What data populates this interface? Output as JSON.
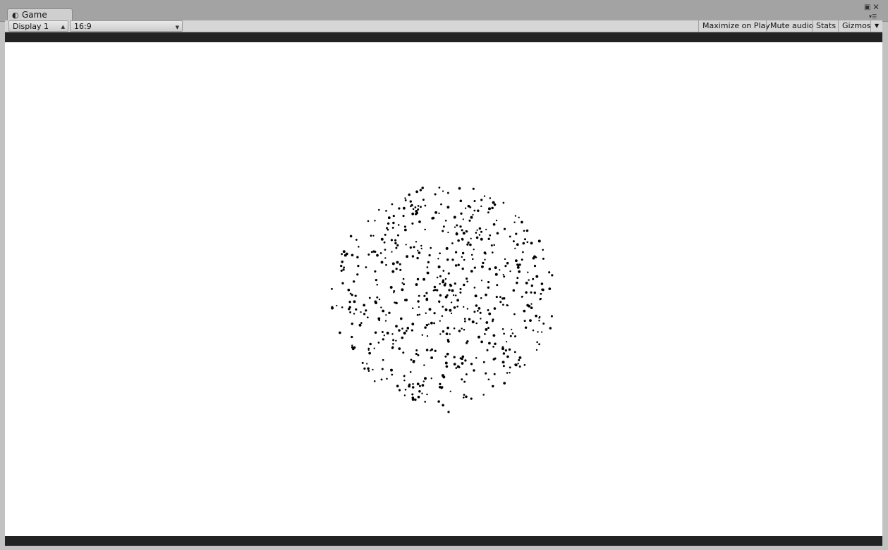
{
  "window": {
    "tab": {
      "label": "Game",
      "icon": "pacman-game-icon"
    }
  },
  "toolbar": {
    "display_select": "Display 1",
    "aspect_select": "16:9",
    "maximize_on_play": "Maximize on Play",
    "mute_audio": "Mute audio",
    "stats": "Stats",
    "gizmos": "Gizmos"
  },
  "scene": {
    "background": "#ffffff",
    "particle_color": "#000000",
    "particle_count": 620
  },
  "colors": {
    "tab_strip": "#a3a3a3",
    "toolbar": "#d6d6d6",
    "letterbox": "#222222"
  }
}
